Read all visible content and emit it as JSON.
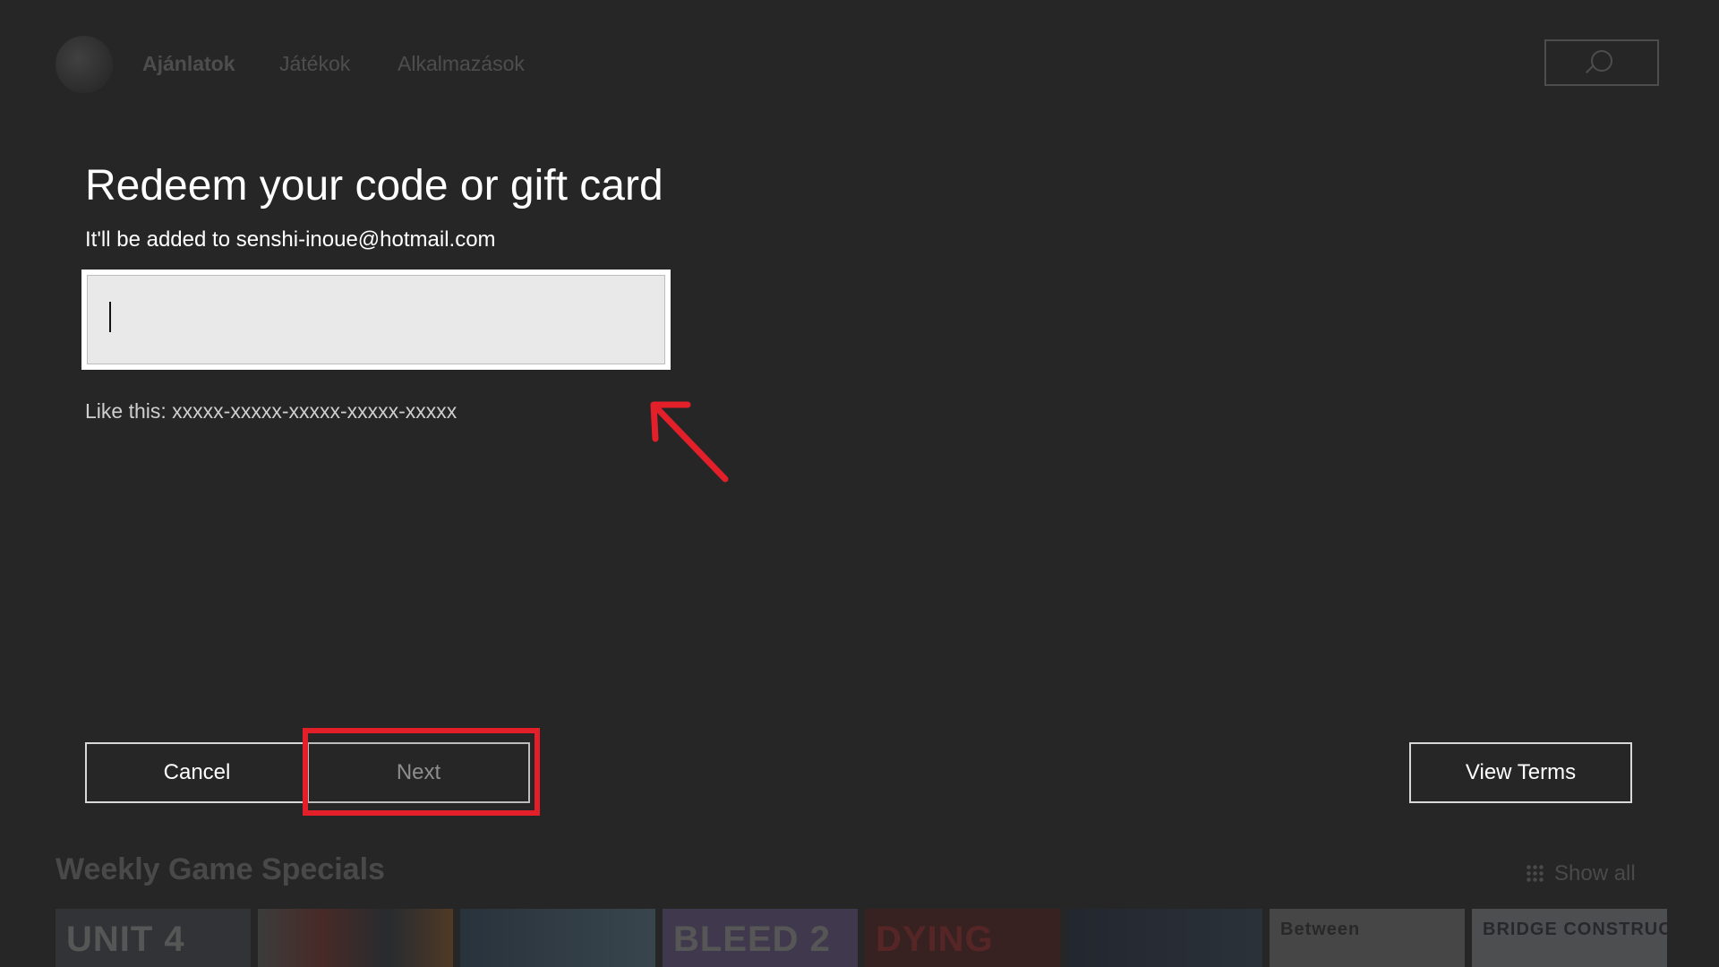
{
  "background": {
    "nav_tabs": [
      "Ajánlatok",
      "Játékok",
      "Alkalmazások"
    ],
    "section_title": "Weekly Game Specials",
    "show_all_label": "Show all",
    "tiles": [
      "UNIT 4",
      "",
      "",
      "BLEED 2",
      "DYING",
      "",
      "Between",
      "BRIDGE CONSTRUCTOR"
    ]
  },
  "dialog": {
    "title": "Redeem your code or gift card",
    "subtitle": "It'll be added to senshi-inoue@hotmail.com",
    "code_input": {
      "value": "",
      "placeholder": ""
    },
    "hint": "Like this: xxxxx-xxxxx-xxxxx-xxxxx-xxxxx",
    "buttons": {
      "cancel": "Cancel",
      "next": "Next",
      "view_terms": "View Terms"
    }
  },
  "colors": {
    "background": "#262626",
    "annotation": "#e3202a",
    "input_bg": "#e9e9e9"
  }
}
